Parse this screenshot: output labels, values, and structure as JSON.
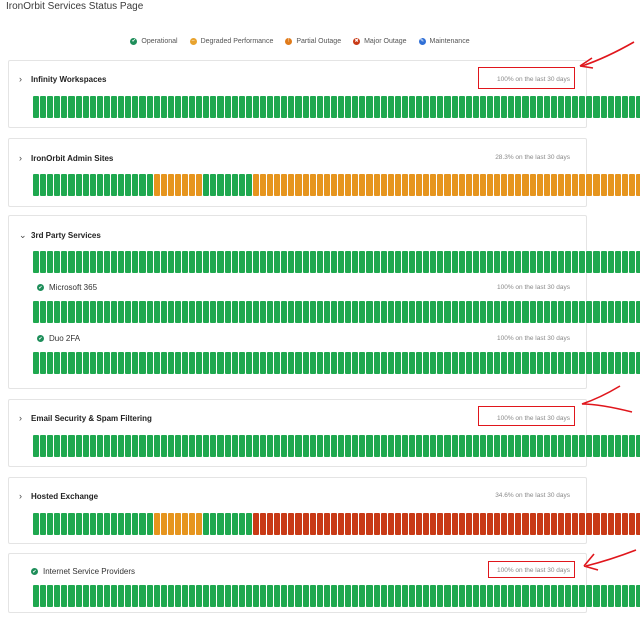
{
  "page": {
    "title": "IronOrbit Services Status Page"
  },
  "legend": [
    {
      "label": "Operational",
      "color": "#1e8e5a",
      "glyph": "✔"
    },
    {
      "label": "Degraded Performance",
      "color": "#e8a32e",
      "glyph": "–"
    },
    {
      "label": "Partial Outage",
      "color": "#e07b1a",
      "glyph": "!"
    },
    {
      "label": "Major Outage",
      "color": "#c83a16",
      "glyph": "✖"
    },
    {
      "label": "Maintenance",
      "color": "#2f6fd6",
      "glyph": "✎"
    }
  ],
  "services": [
    {
      "name": "Infinity Workspaces",
      "uptime": "100% on the last 30 days",
      "chevron": "›",
      "bars": "G90"
    },
    {
      "name": "IronOrbit Admin Sites",
      "uptime": "28.3% on the last 30 days",
      "chevron": "›",
      "bars": "G17,O7,G7,O59"
    },
    {
      "name": "3rd Party Services",
      "uptime": "",
      "chevron": "⌄",
      "bars": "G90",
      "components": [
        {
          "name": "Microsoft 365",
          "uptime": "100% on the last 30 days",
          "bars": "G90"
        },
        {
          "name": "Duo 2FA",
          "uptime": "100% on the last 30 days",
          "bars": "G90"
        }
      ]
    },
    {
      "name": "Email Security & Spam Filtering",
      "uptime": "100% on the last 30 days",
      "chevron": "›",
      "bars": "G90"
    },
    {
      "name": "Hosted Exchange",
      "uptime": "34.6% on the last 30 days",
      "chevron": "›",
      "bars": "G17,O7,G7,R59"
    },
    {
      "name": "Internet Service Providers",
      "uptime": "100% on the last 30 days",
      "chevron": "",
      "bars": "G89"
    }
  ],
  "colors": {
    "operational": "#1fa84f",
    "degraded": "#e6951e",
    "major": "#c83a16",
    "annotation": "#e0161c"
  }
}
